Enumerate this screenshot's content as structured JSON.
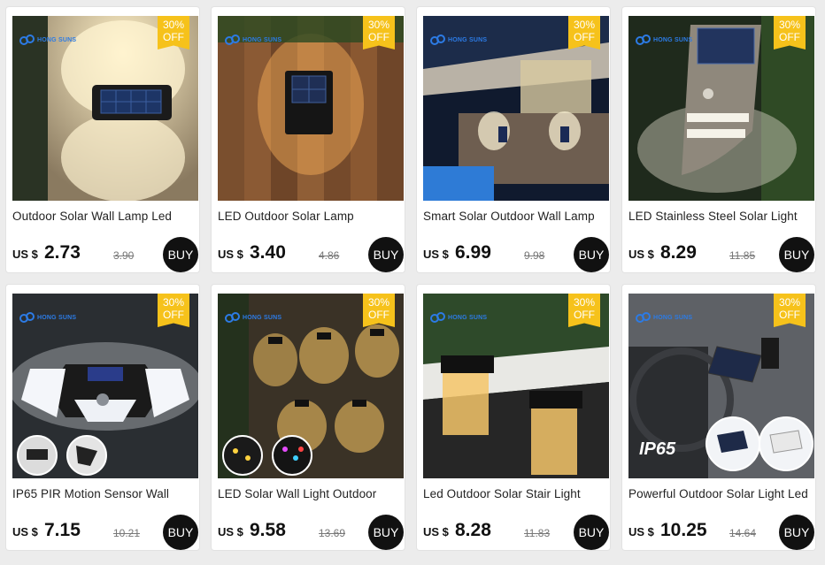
{
  "brand_name": "HONG SUNS",
  "colors": {
    "badge": "#f6c21b",
    "buy_button": "#111111",
    "brand": "#2c7be5"
  },
  "products": [
    {
      "title": "Outdoor Solar Wall Lamp Led",
      "currency": "US $",
      "price": "2.73",
      "old_price": "3.90",
      "discount": "30%",
      "discount_label": "OFF",
      "buy_label": "BUY"
    },
    {
      "title": "LED Outdoor Solar Lamp",
      "currency": "US $",
      "price": "3.40",
      "old_price": "4.86",
      "discount": "30%",
      "discount_label": "OFF",
      "buy_label": "BUY"
    },
    {
      "title": "Smart Solar Outdoor Wall Lamp",
      "currency": "US $",
      "price": "6.99",
      "old_price": "9.98",
      "discount": "30%",
      "discount_label": "OFF",
      "buy_label": "BUY"
    },
    {
      "title": "LED Stainless Steel Solar Light",
      "currency": "US $",
      "price": "8.29",
      "old_price": "11.85",
      "discount": "30%",
      "discount_label": "OFF",
      "buy_label": "BUY"
    },
    {
      "title": "IP65 PIR Motion Sensor Wall",
      "currency": "US $",
      "price": "7.15",
      "old_price": "10.21",
      "discount": "30%",
      "discount_label": "OFF",
      "buy_label": "BUY"
    },
    {
      "title": "LED Solar Wall Light Outdoor",
      "currency": "US $",
      "price": "9.58",
      "old_price": "13.69",
      "discount": "30%",
      "discount_label": "OFF",
      "buy_label": "BUY"
    },
    {
      "title": "Led Outdoor Solar Stair Light",
      "currency": "US $",
      "price": "8.28",
      "old_price": "11.83",
      "discount": "30%",
      "discount_label": "OFF",
      "buy_label": "BUY"
    },
    {
      "title": "Powerful Outdoor Solar Light Led",
      "currency": "US $",
      "price": "10.25",
      "old_price": "14.64",
      "discount": "30%",
      "discount_label": "OFF",
      "buy_label": "BUY"
    }
  ],
  "image_text": {
    "ip65": "IP65"
  }
}
